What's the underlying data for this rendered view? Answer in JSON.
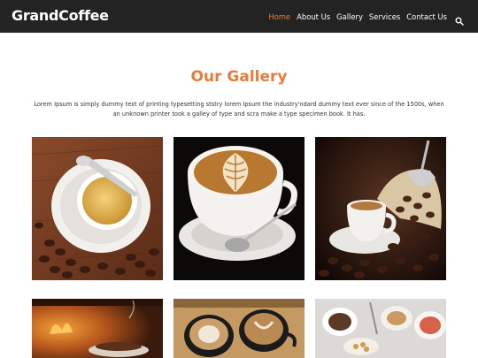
{
  "brand": {
    "name": "GrandCoffee"
  },
  "nav": {
    "items": [
      {
        "label": "Home",
        "active": true
      },
      {
        "label": "About Us",
        "active": false
      },
      {
        "label": "Gallery",
        "active": false
      },
      {
        "label": "Services",
        "active": false
      },
      {
        "label": "Contact Us",
        "active": false
      }
    ],
    "search_icon": "search-icon"
  },
  "gallery": {
    "title": "Our Gallery",
    "description": "Lorem Ipsum is simply dummy text of printing typesetting ststry lorem Ipsum the industry'ndard dummy text ever since of the 1500s, when an unknown printer took a galley of type and scra make a type specimen book. It has."
  },
  "colors": {
    "accent": "#e87c3a",
    "navbar": "#232323"
  }
}
